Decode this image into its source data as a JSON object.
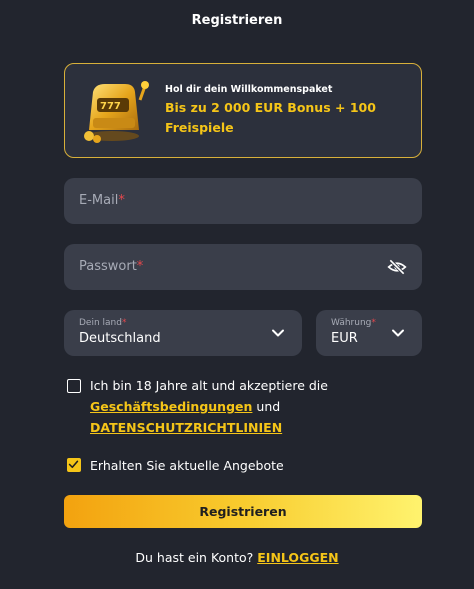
{
  "header": {
    "title": "Registrieren"
  },
  "promo": {
    "small": "Hol dir dein Willkommenspaket",
    "big": "Bis zu 2 000 EUR Bonus + 100 Freispiele",
    "icon": "slot-machine-icon"
  },
  "form": {
    "email": {
      "placeholder": "E-Mail",
      "required_mark": "*"
    },
    "password": {
      "placeholder": "Passwort",
      "required_mark": "*",
      "icon": "eye-slash-icon"
    },
    "country": {
      "label": "Dein land",
      "required_mark": "*",
      "value": "Deutschland"
    },
    "currency": {
      "label": "Währung",
      "required_mark": "*",
      "value": "EUR"
    },
    "terms": {
      "checked": false,
      "line1": "Ich bin 18 Jahre alt und akzeptiere die",
      "link1": "Geschäftsbedingungen",
      "and": "und",
      "link2": "DATENSCHUTZRICHTLINIEN"
    },
    "offers": {
      "checked": true,
      "label": "Erhalten Sie aktuelle Angebote"
    },
    "submit_label": "Registrieren"
  },
  "footer": {
    "text": "Du hast ein Konto?",
    "link": "EINLOGGEN"
  },
  "colors": {
    "background": "#22252e",
    "field": "#3a3e4a",
    "accent": "#f5c518",
    "required": "#e5484d"
  }
}
